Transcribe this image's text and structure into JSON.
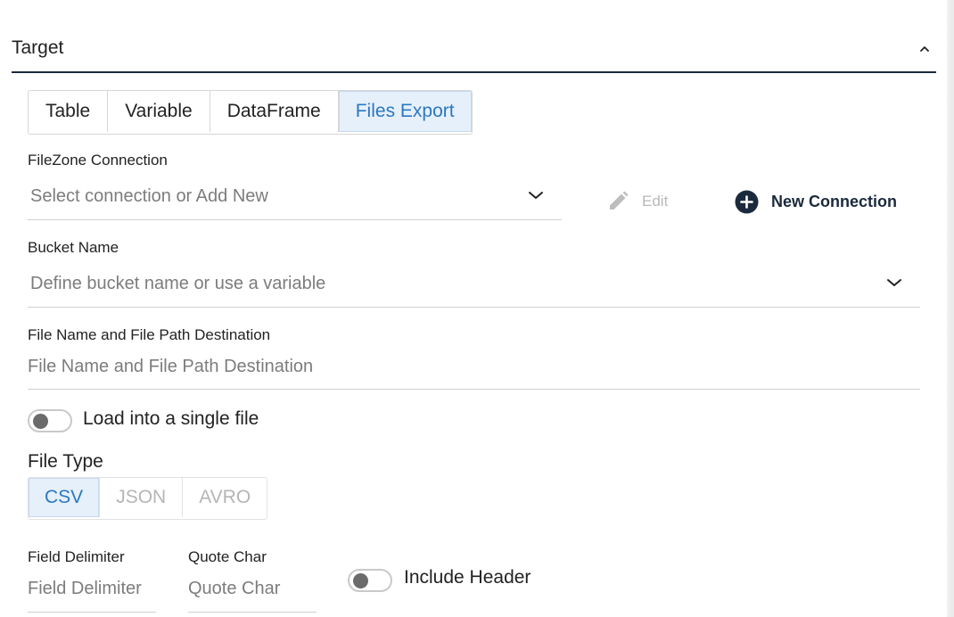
{
  "section": {
    "title": "Target"
  },
  "tabs": [
    {
      "label": "Table",
      "active": false
    },
    {
      "label": "Variable",
      "active": false
    },
    {
      "label": "DataFrame",
      "active": false
    },
    {
      "label": "Files Export",
      "active": true
    }
  ],
  "connection": {
    "label": "FileZone Connection",
    "placeholder": "Select connection or Add New",
    "edit_label": "Edit",
    "new_label": "New Connection"
  },
  "bucket": {
    "label": "Bucket Name",
    "placeholder": "Define bucket name or use a variable"
  },
  "filepath": {
    "label": "File Name and File Path Destination",
    "placeholder": "File Name and File Path Destination"
  },
  "single_file": {
    "label": "Load into a single file",
    "checked": false
  },
  "file_type": {
    "label": "File Type",
    "options": [
      "CSV",
      "JSON",
      "AVRO"
    ],
    "selected": "CSV"
  },
  "delimiter": {
    "label": "Field Delimiter",
    "placeholder": "Field Delimiter"
  },
  "quote": {
    "label": "Quote Char",
    "placeholder": "Quote Char"
  },
  "include_header": {
    "label": "Include Header",
    "checked": false
  },
  "colors": {
    "accent": "#2b78c2",
    "dark": "#1b2a3c",
    "active_bg": "#e6f0fa"
  },
  "icons": [
    "chevron-up-icon",
    "chevron-down-icon",
    "pencil-icon",
    "plus-circle-icon"
  ]
}
